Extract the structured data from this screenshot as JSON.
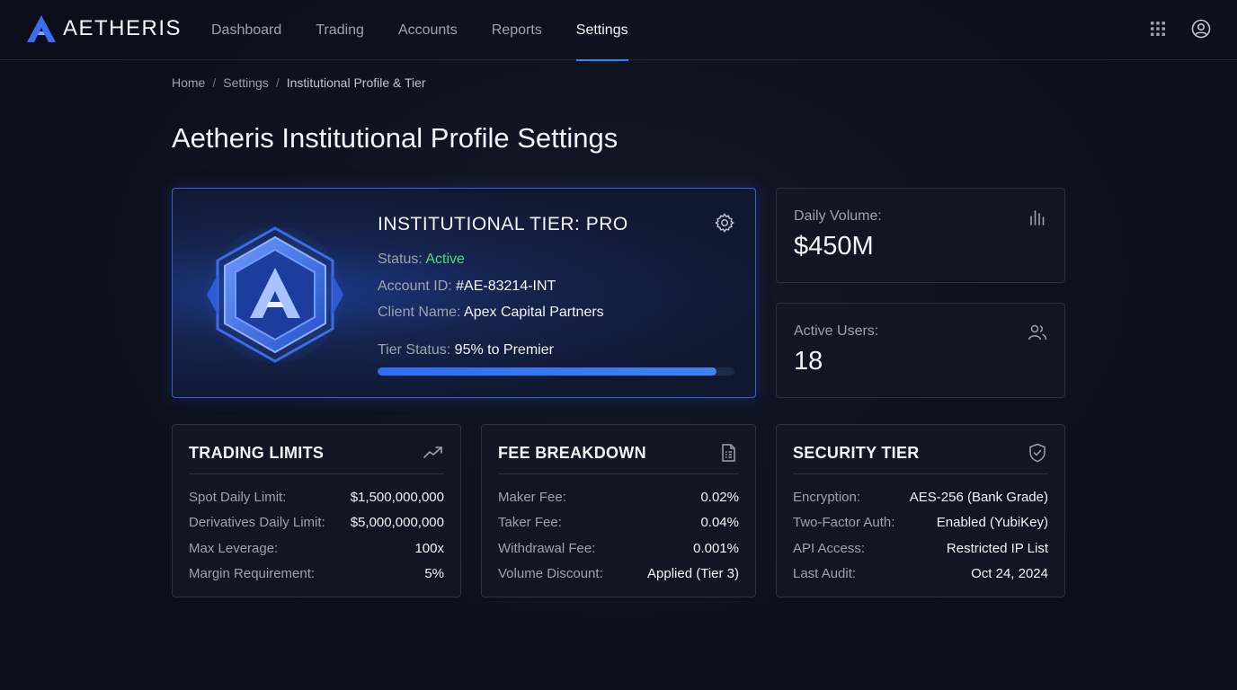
{
  "brand": {
    "name": "AETHERIS"
  },
  "nav": {
    "items": [
      {
        "label": "Dashboard"
      },
      {
        "label": "Trading"
      },
      {
        "label": "Accounts"
      },
      {
        "label": "Reports"
      },
      {
        "label": "Settings"
      }
    ],
    "active": "Settings"
  },
  "header_icons": [
    "apps-grid-icon",
    "user-account-icon"
  ],
  "breadcrumb": {
    "home": "Home",
    "settings": "Settings",
    "current": "Institutional Profile & Tier",
    "separator": "/"
  },
  "page": {
    "title": "Aetheris Institutional Profile Settings"
  },
  "tier": {
    "title": "INSTITUTIONAL TIER: PRO",
    "status_label": "Status:",
    "status_value": "Active",
    "account_label": "Account ID:",
    "account_value": "#AE-83214-INT",
    "client_label": "Client Name:",
    "client_value": "Apex Capital Partners",
    "tier_status_label": "Tier Status:",
    "tier_status_value": "95% to Premier",
    "progress_percent": 95
  },
  "stats": {
    "volume": {
      "label": "Daily Volume:",
      "value": "$450M"
    },
    "users": {
      "label": "Active Users:",
      "value": "18"
    }
  },
  "trading_limits": {
    "title": "TRADING LIMITS",
    "rows": [
      {
        "k": "Spot Daily Limit:",
        "v": "$1,500,000,000"
      },
      {
        "k": "Derivatives Daily Limit:",
        "v": "$5,000,000,000"
      },
      {
        "k": "Max Leverage:",
        "v": "100x"
      },
      {
        "k": "Margin Requirement:",
        "v": "5%"
      }
    ]
  },
  "fee_breakdown": {
    "title": "FEE BREAKDOWN",
    "rows": [
      {
        "k": "Maker Fee:",
        "v": "0.02%"
      },
      {
        "k": "Taker Fee:",
        "v": "0.04%"
      },
      {
        "k": "Withdrawal Fee:",
        "v": "0.001%"
      },
      {
        "k": "Volume Discount:",
        "v": "Applied (Tier 3)"
      }
    ]
  },
  "security_tier": {
    "title": "SECURITY TIER",
    "rows": [
      {
        "k": "Encryption:",
        "v": "AES-256 (Bank Grade)"
      },
      {
        "k": "Two-Factor Auth:",
        "v": "Enabled (YubiKey)"
      },
      {
        "k": "API Access:",
        "v": "Restricted IP List"
      },
      {
        "k": "Last Audit:",
        "v": "Oct 24, 2024"
      }
    ]
  },
  "colors": {
    "accent": "#3b82f6",
    "active_status": "#4ade80",
    "background": "#0b0f1a"
  }
}
